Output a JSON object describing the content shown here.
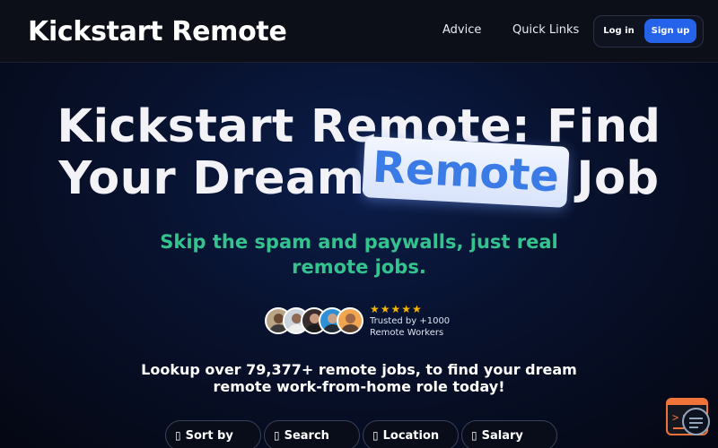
{
  "header": {
    "brand": "Kickstart Remote",
    "nav": [
      "Advice",
      "Quick Links"
    ],
    "login_label": "Log in",
    "signup_label": "Sign up"
  },
  "hero": {
    "title_line_1": "Kickstart Remote: Find",
    "title_line_2_pre": "Your Dream",
    "title_highlight": "Remote",
    "title_line_2_post": "Job",
    "subtitle": "Skip the spam and paywalls, just real remote jobs."
  },
  "social_proof": {
    "rating_stars": 5,
    "stars_text": "★★★★★",
    "trusted_line_1": "Trusted by +1000",
    "trusted_line_2": "Remote Workers",
    "avatar_count": 5
  },
  "lookup_text": "Lookup over 79,377+ remote jobs, to find your dream remote work-from-home role today!",
  "filters": [
    {
      "icon": "sort-icon",
      "glyph": "▯",
      "label": "Sort by"
    },
    {
      "icon": "search-icon",
      "glyph": "▯",
      "label": "Search"
    },
    {
      "icon": "location-icon",
      "glyph": "▯",
      "label": "Location"
    },
    {
      "icon": "salary-icon",
      "glyph": "▯",
      "label": "Salary"
    }
  ],
  "colors": {
    "accent_blue": "#2563eb",
    "subtitle_green": "#34c38f",
    "highlight_text": "#3b7be6",
    "star_gold": "#f5b400",
    "widget_orange": "#f0743a"
  }
}
